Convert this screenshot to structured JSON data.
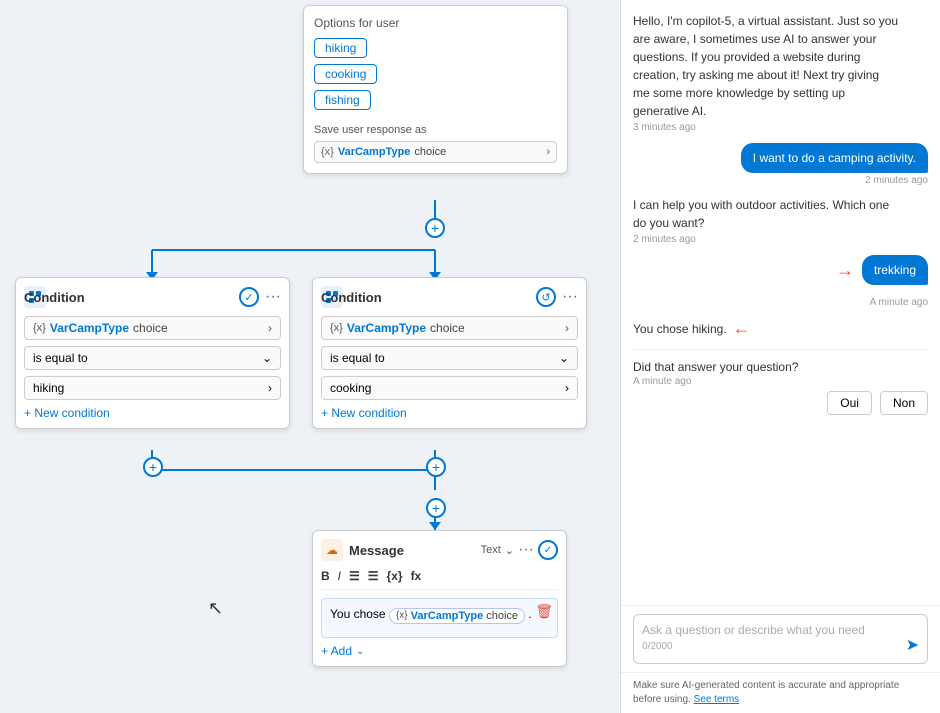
{
  "canvas": {
    "options_node": {
      "title": "Options for user",
      "options": [
        "hiking",
        "cooking",
        "fishing"
      ],
      "save_label": "Save user response as",
      "variable": "{x}",
      "var_name": "VarCampType",
      "var_type": "choice"
    },
    "condition1": {
      "title": "Condition",
      "var_icon": "{x}",
      "var_name": "VarCampType",
      "var_type": "choice",
      "operator": "is equal to",
      "value": "hiking",
      "add_condition": "+ New condition"
    },
    "condition2": {
      "title": "Condition",
      "var_icon": "{x}",
      "var_name": "VarCampType",
      "var_type": "choice",
      "operator": "is equal to",
      "value": "cooking",
      "add_condition": "+ New condition"
    },
    "message_node": {
      "title": "Message",
      "type": "Text",
      "text_before": "You chose",
      "var_icon": "{x}",
      "var_name": "VarCampType",
      "var_type": "choice",
      "text_after": ".",
      "add_label": "+ Add"
    }
  },
  "toolbar": {
    "bold": "B",
    "italic": "I",
    "list_unordered": "≡",
    "list_ordered": "≡",
    "variable": "{x}",
    "formula": "fx"
  },
  "chat": {
    "bot_msg1": "Hello, I'm copilot-5, a virtual assistant. Just so you are aware, I sometimes use AI to answer your questions. If you provided a website during creation, try asking me about it! Next try giving me some more knowledge by setting up generative AI.",
    "time1": "3 minutes ago",
    "user_msg1": "I want to do a camping activity.",
    "time2": "2 minutes ago",
    "bot_msg2": "I can help you with outdoor activities. Which one do you want?",
    "time3": "2 minutes ago",
    "user_msg2": "trekking",
    "time4": "A minute ago",
    "bot_msg3": "You chose hiking.",
    "bot_msg4": "Did that answer your question?",
    "time5": "A minute ago",
    "btn_yes": "Oui",
    "btn_no": "Non",
    "input_placeholder": "Ask a question or describe what you need",
    "char_count": "0/2000",
    "disclaimer": "Make sure AI-generated content is accurate and appropriate before using.",
    "see_terms": "See terms"
  }
}
